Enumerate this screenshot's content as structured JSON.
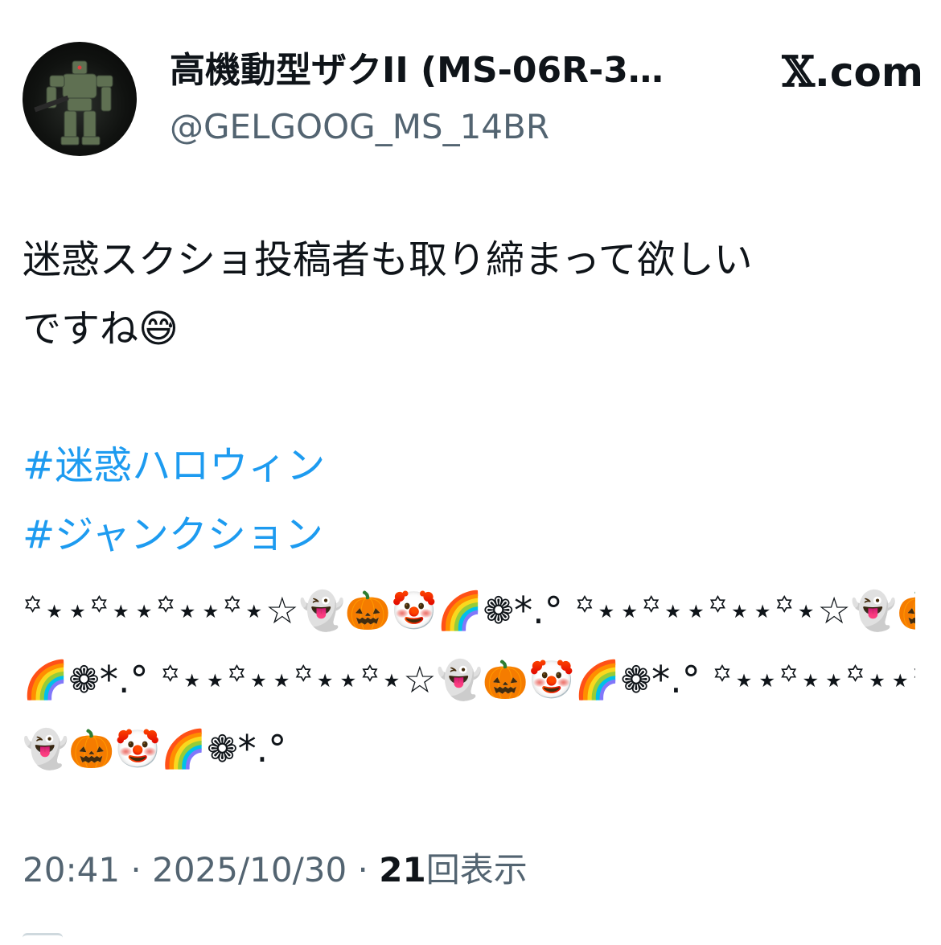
{
  "author": {
    "display_name": "高機動型ザクII (MS-06R-3…",
    "handle": "@GELGOOG_MS_14BR"
  },
  "brand": {
    "x_glyph": "𝕏",
    "text": ".com"
  },
  "post": {
    "text_lines": [
      "迷惑スクショ投稿者も取り締まって欲しい",
      "ですね😅"
    ],
    "hashtags": [
      "#迷惑ハロウィン",
      "#ジャンクション"
    ],
    "decoration_lines": [
      "꙳⋆⋆꙳⋆⋆꙳⋆⋆꙳⋆☆👻🎃🤡🌈❁*.°  ꙳⋆⋆꙳⋆⋆꙳⋆⋆꙳⋆☆👻🎃🤡",
      "🌈❁*.°  ꙳⋆⋆꙳⋆⋆꙳⋆⋆꙳⋆☆👻🎃🤡🌈❁*.°  ꙳⋆⋆꙳⋆⋆꙳⋆⋆꙳⋆☆",
      "👻🎃🤡🌈❁*.°"
    ]
  },
  "meta": {
    "time": "20:41",
    "separator": " · ",
    "date": "2025/10/30",
    "views_count": "21",
    "views_label": "回表示"
  }
}
